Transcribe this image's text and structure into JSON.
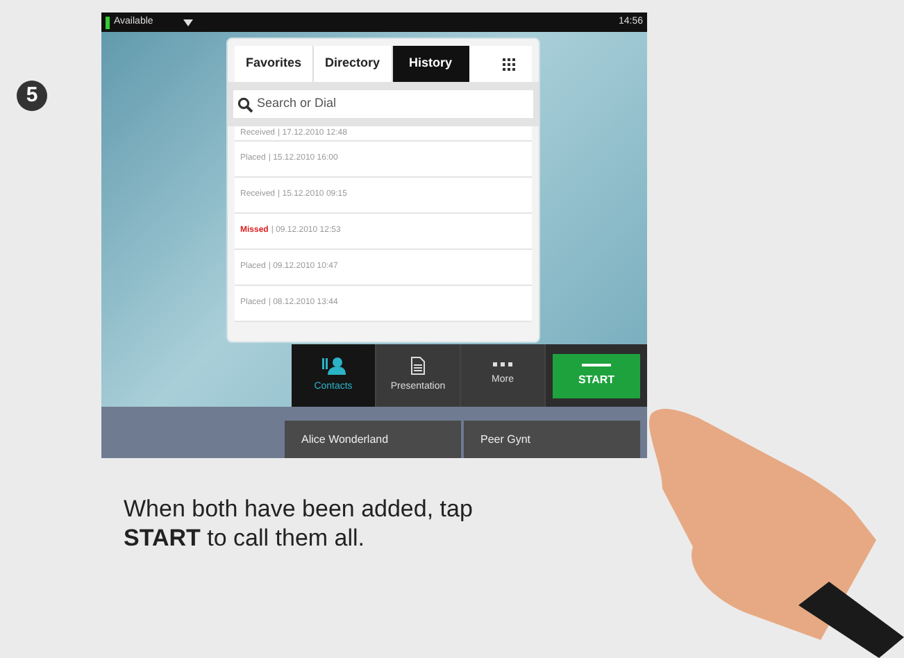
{
  "step": "5",
  "status_bar": {
    "presence": "Available",
    "time": "14:56"
  },
  "tabs": [
    {
      "label": "Favorites",
      "selected": false
    },
    {
      "label": "Directory",
      "selected": false
    },
    {
      "label": "History",
      "selected": true
    }
  ],
  "search": {
    "placeholder": "Search or Dial"
  },
  "history": [
    {
      "status": "Received",
      "time": "| 17.12.2010 12:48",
      "missed": false
    },
    {
      "status": "Placed",
      "time": "| 15.12.2010 16:00",
      "missed": false
    },
    {
      "status": "Received",
      "time": "| 15.12.2010 09:15",
      "missed": false
    },
    {
      "status": "Missed",
      "time": "| 09.12.2010 12:53",
      "missed": true
    },
    {
      "status": "Placed",
      "time": "| 09.12.2010 10:47",
      "missed": false
    },
    {
      "status": "Placed",
      "time": "| 08.12.2010 13:44",
      "missed": false
    }
  ],
  "toolbar": [
    {
      "label": "Contacts",
      "kind": "contacts",
      "selected": true
    },
    {
      "label": "Presentation",
      "kind": "presentation",
      "selected": false
    },
    {
      "label": "More",
      "kind": "more",
      "selected": false
    }
  ],
  "start_button": "START",
  "participants": [
    "Alice Wonderland",
    "Peer Gynt"
  ],
  "caption": "When both have been added, tap **START** to call them all."
}
